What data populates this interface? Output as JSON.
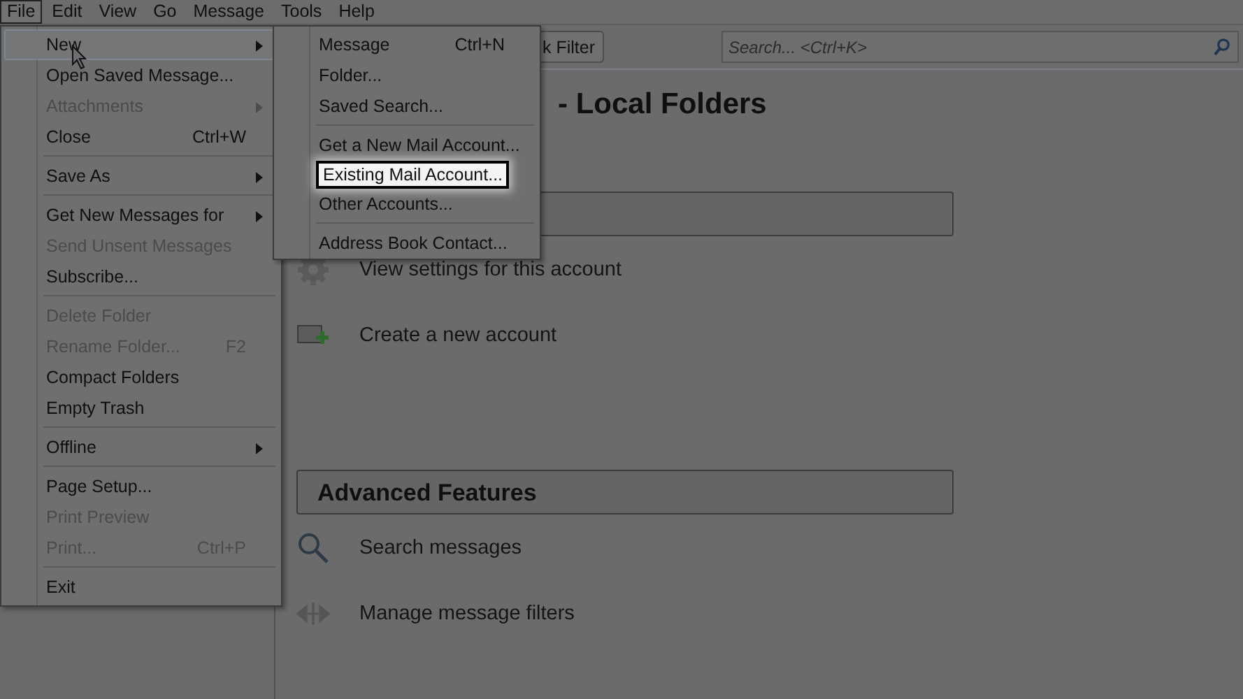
{
  "menubar": [
    {
      "label": "File",
      "selected": true
    },
    {
      "label": "Edit",
      "selected": false
    },
    {
      "label": "View",
      "selected": false
    },
    {
      "label": "Go",
      "selected": false
    },
    {
      "label": "Message",
      "selected": false
    },
    {
      "label": "Tools",
      "selected": false
    },
    {
      "label": "Help",
      "selected": false
    }
  ],
  "toolbar": {
    "filter_button": "k Filter",
    "search": {
      "placeholder": "Search... <Ctrl+K>"
    }
  },
  "content": {
    "title": "- Local Folders",
    "sections": [
      {
        "items": [
          {
            "kind": "settings",
            "label": "View settings for this account"
          },
          {
            "kind": "new-account",
            "label": "Create a new account"
          }
        ]
      },
      {
        "heading": "Advanced Features",
        "items": [
          {
            "kind": "search",
            "label": "Search messages"
          },
          {
            "kind": "filters",
            "label": "Manage message filters"
          }
        ]
      }
    ]
  },
  "file_menu": {
    "items": [
      {
        "kind": "item",
        "label": "New",
        "selected": true,
        "disabled": false,
        "submenu": true
      },
      {
        "kind": "item",
        "label": "Open Saved Message...",
        "selected": false,
        "disabled": false,
        "submenu": false
      },
      {
        "kind": "item",
        "label": "Attachments",
        "selected": false,
        "disabled": true,
        "submenu": true
      },
      {
        "kind": "item",
        "label": "Close",
        "shortcut": "Ctrl+W",
        "selected": false,
        "disabled": false,
        "submenu": false
      },
      {
        "kind": "separator"
      },
      {
        "kind": "item",
        "label": "Save As",
        "selected": false,
        "disabled": false,
        "submenu": true
      },
      {
        "kind": "separator"
      },
      {
        "kind": "item",
        "label": "Get New Messages for",
        "selected": false,
        "disabled": false,
        "submenu": true
      },
      {
        "kind": "item",
        "label": "Send Unsent Messages",
        "selected": false,
        "disabled": true,
        "submenu": false
      },
      {
        "kind": "item",
        "label": "Subscribe...",
        "selected": false,
        "disabled": false,
        "submenu": false
      },
      {
        "kind": "separator"
      },
      {
        "kind": "item",
        "label": "Delete Folder",
        "selected": false,
        "disabled": true,
        "submenu": false
      },
      {
        "kind": "item",
        "label": "Rename Folder...",
        "shortcut": "F2",
        "selected": false,
        "disabled": true,
        "submenu": false
      },
      {
        "kind": "item",
        "label": "Compact Folders",
        "selected": false,
        "disabled": false,
        "submenu": false
      },
      {
        "kind": "item",
        "label": "Empty Trash",
        "selected": false,
        "disabled": false,
        "submenu": false
      },
      {
        "kind": "separator"
      },
      {
        "kind": "item",
        "label": "Offline",
        "selected": false,
        "disabled": false,
        "submenu": true
      },
      {
        "kind": "separator"
      },
      {
        "kind": "item",
        "label": "Page Setup...",
        "selected": false,
        "disabled": false,
        "submenu": false
      },
      {
        "kind": "item",
        "label": "Print Preview",
        "selected": false,
        "disabled": true,
        "submenu": false
      },
      {
        "kind": "item",
        "label": "Print...",
        "shortcut": "Ctrl+P",
        "selected": false,
        "disabled": true,
        "submenu": false
      },
      {
        "kind": "separator"
      },
      {
        "kind": "item",
        "label": "Exit",
        "selected": false,
        "disabled": false,
        "submenu": false
      }
    ]
  },
  "new_submenu": {
    "items": [
      {
        "kind": "item",
        "label": "Message",
        "shortcut": "Ctrl+N",
        "selected": false
      },
      {
        "kind": "item",
        "label": "Folder...",
        "selected": false
      },
      {
        "kind": "item",
        "label": "Saved Search...",
        "selected": false
      },
      {
        "kind": "separator"
      },
      {
        "kind": "item",
        "label": "Get a New Mail Account...",
        "selected": false
      },
      {
        "kind": "item",
        "label": "Existing Mail Account...",
        "selected": true
      },
      {
        "kind": "item",
        "label": "Other Accounts...",
        "selected": false
      },
      {
        "kind": "separator"
      },
      {
        "kind": "item",
        "label": "Address Book Contact...",
        "selected": false
      }
    ]
  }
}
